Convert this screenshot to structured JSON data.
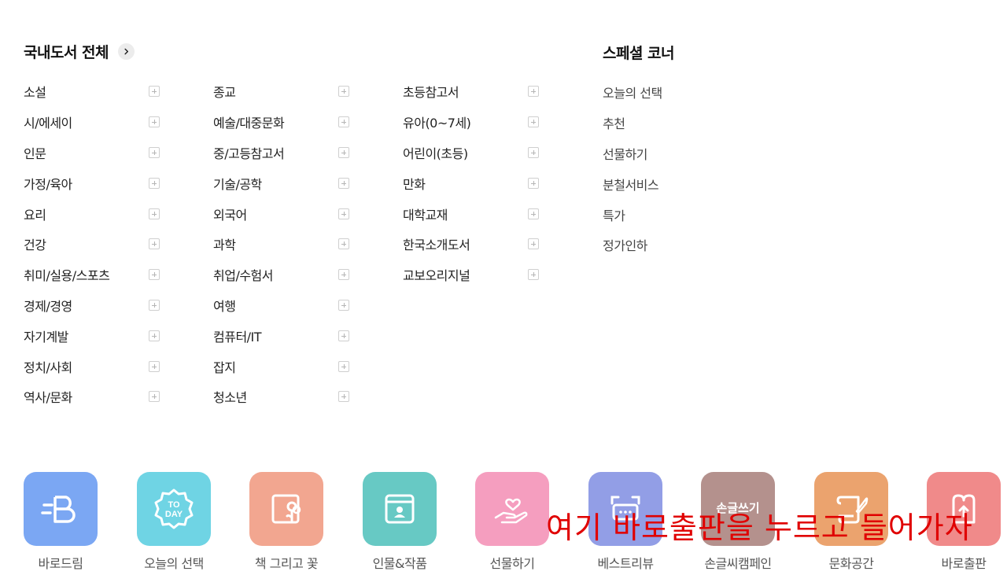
{
  "domestic": {
    "title": "국내도서 전체",
    "columns": [
      [
        "소설",
        "시/에세이",
        "인문",
        "가정/육아",
        "요리",
        "건강",
        "취미/실용/스포츠",
        "경제/경영",
        "자기계발",
        "정치/사회",
        "역사/문화"
      ],
      [
        "종교",
        "예술/대중문화",
        "중/고등참고서",
        "기술/공학",
        "외국어",
        "과학",
        "취업/수험서",
        "여행",
        "컴퓨터/IT",
        "잡지",
        "청소년"
      ],
      [
        "초등참고서",
        "유아(0~7세)",
        "어린이(초등)",
        "만화",
        "대학교재",
        "한국소개도서",
        "교보오리지널"
      ]
    ]
  },
  "special": {
    "title": "스페셜 코너",
    "items": [
      "오늘의 선택",
      "추천",
      "선물하기",
      "분철서비스",
      "특가",
      "정가인하"
    ]
  },
  "shortcuts": [
    {
      "label": "바로드림",
      "icon": "baro-dream-icon",
      "color": "#7ba7f3"
    },
    {
      "label": "오늘의 선택",
      "icon": "today-badge-icon",
      "color": "#6fd4e4"
    },
    {
      "label": "책 그리고 꽃",
      "icon": "book-flower-icon",
      "color": "#f2a690"
    },
    {
      "label": "인물&작품",
      "icon": "person-card-icon",
      "color": "#67c9c4"
    },
    {
      "label": "선물하기",
      "icon": "gift-hand-heart-icon",
      "color": "#f59ebf"
    },
    {
      "label": "베스트리뷰",
      "icon": "review-chat-icon",
      "color": "#929ee6"
    },
    {
      "label": "손글씨캠페인",
      "icon": "handwriting-icon",
      "color": "#b4918d",
      "icon_text": "손글쓰기"
    },
    {
      "label": "문화공간",
      "icon": "scroll-pen-icon",
      "color": "#eba36e"
    },
    {
      "label": "바로출판",
      "icon": "baro-publish-icon",
      "color": "#f08a8a"
    }
  ],
  "annotation": "여기 바로출판을 누르고 들어가자"
}
